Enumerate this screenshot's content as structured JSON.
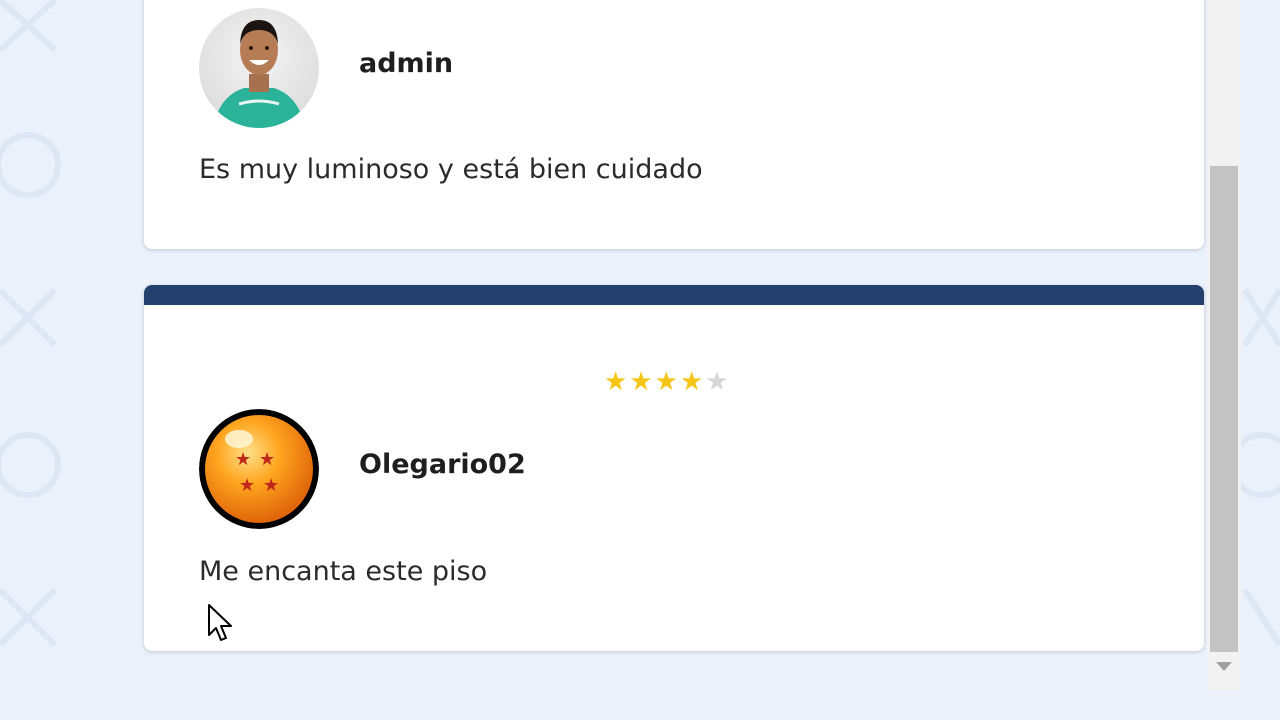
{
  "reviews": [
    {
      "username": "admin",
      "comment": "Es muy luminoso y está bien cuidado",
      "avatar": "person-avatar"
    },
    {
      "username": "Olegario02",
      "comment": "Me encanta este piso",
      "avatar": "dragon-ball-avatar",
      "rating": 4,
      "rating_max": 5
    }
  ],
  "colors": {
    "page_background": "#eaf1fb",
    "card_header": "#22406b",
    "star_filled": "#f5c518",
    "star_empty": "#d6d6d6"
  },
  "icons": {
    "star_filled": "★",
    "star_empty": "★"
  }
}
